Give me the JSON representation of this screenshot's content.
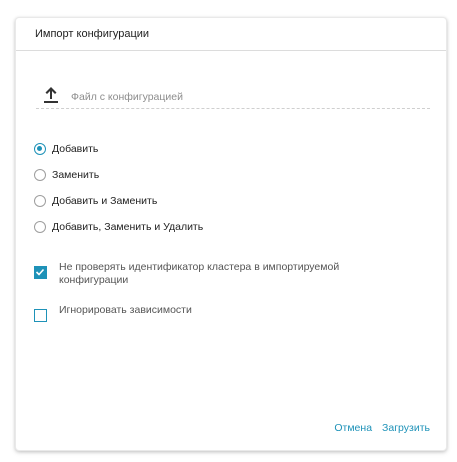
{
  "dialog": {
    "title": "Импорт конфигурации",
    "file_placeholder": "Файл с конфигурацией",
    "upload_icon": "upload-icon",
    "mode_options": [
      {
        "label": "Добавить",
        "checked": true
      },
      {
        "label": "Заменить",
        "checked": false
      },
      {
        "label": "Добавить и Заменить",
        "checked": false
      },
      {
        "label": "Добавить, Заменить и Удалить",
        "checked": false
      }
    ],
    "checkboxes": [
      {
        "label": "Не проверять идентификатор кластера в импортируемой конфигурации",
        "checked": true
      },
      {
        "label": "Игнорировать зависимости",
        "checked": false
      }
    ],
    "cancel_label": "Отмена",
    "submit_label": "Загрузить"
  },
  "colors": {
    "accent": "#1e92b8",
    "text": "#222222",
    "muted": "#8d8d8d"
  }
}
